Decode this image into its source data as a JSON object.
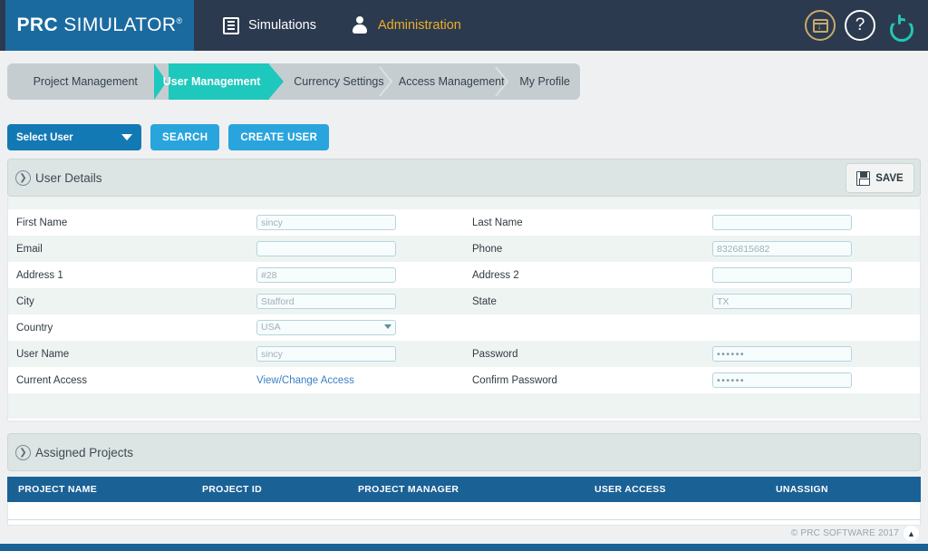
{
  "header": {
    "logo_bold": "PRC",
    "logo_light": " SIMULATOR",
    "logo_reg": "®",
    "nav": [
      {
        "label": "Simulations",
        "icon": "list-icon",
        "active": false
      },
      {
        "label": "Administration",
        "icon": "user-icon",
        "active": true
      }
    ],
    "icons": [
      {
        "name": "window-download-icon"
      },
      {
        "name": "help-icon",
        "glyph": "?"
      },
      {
        "name": "power-icon"
      }
    ]
  },
  "tabs": [
    {
      "label": "Project Management",
      "active": false
    },
    {
      "label": "User Management",
      "active": true
    },
    {
      "label": "Currency Settings",
      "active": false
    },
    {
      "label": "Access Management",
      "active": false
    },
    {
      "label": "My Profile",
      "active": false
    }
  ],
  "toolbar": {
    "select_user_label": "Select User",
    "search_label": "SEARCH",
    "create_user_label": "CREATE USER"
  },
  "user_details": {
    "title": "User Details",
    "save_label": "SAVE",
    "fields": [
      {
        "label": "First Name",
        "value": "sincy",
        "type": "text"
      },
      {
        "label": "Last Name",
        "value": "",
        "type": "text"
      },
      {
        "label": "Email",
        "value": "",
        "type": "text"
      },
      {
        "label": "Phone",
        "value": "8326815682",
        "type": "text"
      },
      {
        "label": "Address 1",
        "value": "#28",
        "type": "text"
      },
      {
        "label": "Address 2",
        "value": "",
        "type": "text"
      },
      {
        "label": "City",
        "value": "Stafford",
        "type": "text"
      },
      {
        "label": "State",
        "value": "TX",
        "type": "text"
      },
      {
        "label": "Country",
        "value": "USA",
        "type": "select"
      },
      {
        "label": "",
        "value": "",
        "type": "empty"
      },
      {
        "label": "User Name",
        "value": "sincy",
        "type": "text"
      },
      {
        "label": "Password",
        "value": "••••••",
        "type": "password"
      },
      {
        "label": "Current Access",
        "value": "View/Change Access",
        "type": "link"
      },
      {
        "label": "Confirm Password",
        "value": "••••••",
        "type": "password"
      }
    ]
  },
  "assigned_projects": {
    "title": "Assigned Projects",
    "columns": [
      "PROJECT NAME",
      "PROJECT ID",
      "PROJECT MANAGER",
      "USER ACCESS",
      "UNASSIGN"
    ],
    "rows": []
  },
  "footer": {
    "copyright": "© PRC SOFTWARE 2017",
    "to_top_glyph": "▲"
  },
  "colors": {
    "navy": "#2b3a4f",
    "logo_blue": "#1a6aa0",
    "teal": "#1ec8bd",
    "accent_gold": "#f0ad28",
    "button_blue": "#2aa4dd",
    "select_blue": "#1379b4",
    "table_header_blue": "#1a6196",
    "tab_gray": "#c6cdd1",
    "row_alt": "#eef4f2",
    "link_blue": "#3b7fc4"
  }
}
